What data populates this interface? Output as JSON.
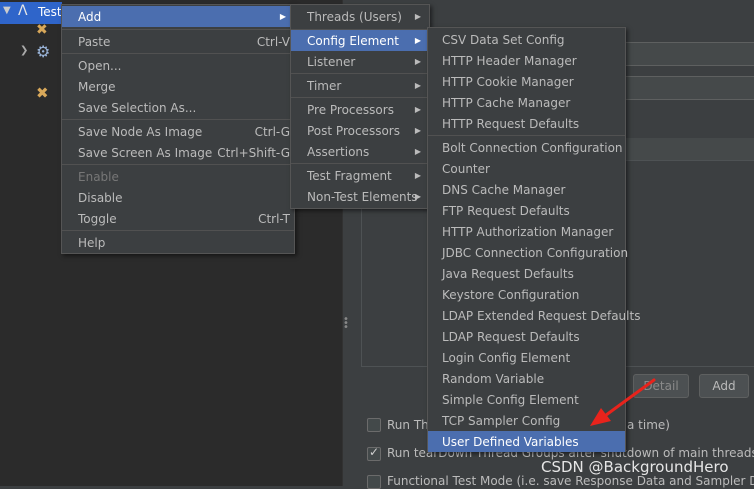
{
  "tree": {
    "selected_label": "Test"
  },
  "context_menu": {
    "items": [
      {
        "label": "Add",
        "shortcut": "",
        "submenu": true
      },
      {
        "label": "Paste",
        "shortcut": "Ctrl-V"
      },
      {
        "label": "Open...",
        "shortcut": ""
      },
      {
        "label": "Merge",
        "shortcut": ""
      },
      {
        "label": "Save Selection As...",
        "shortcut": ""
      },
      {
        "label": "Save Node As Image",
        "shortcut": "Ctrl-G"
      },
      {
        "label": "Save Screen As Image",
        "shortcut": "Ctrl+Shift-G"
      },
      {
        "label": "Enable",
        "shortcut": "",
        "disabled": true
      },
      {
        "label": "Disable",
        "shortcut": ""
      },
      {
        "label": "Toggle",
        "shortcut": "Ctrl-T"
      },
      {
        "label": "Help",
        "shortcut": ""
      }
    ]
  },
  "add_menu": {
    "items": [
      {
        "label": "Threads (Users)"
      },
      {
        "label": "Config Element"
      },
      {
        "label": "Listener"
      },
      {
        "label": "Timer"
      },
      {
        "label": "Pre Processors"
      },
      {
        "label": "Post Processors"
      },
      {
        "label": "Assertions"
      },
      {
        "label": "Test Fragment"
      },
      {
        "label": "Non-Test Elements"
      }
    ]
  },
  "config_menu": {
    "items": [
      "CSV Data Set Config",
      "HTTP Header Manager",
      "HTTP Cookie Manager",
      "HTTP Cache Manager",
      "HTTP Request Defaults",
      "Bolt Connection Configuration",
      "Counter",
      "DNS Cache Manager",
      "FTP Request Defaults",
      "HTTP Authorization Manager",
      "JDBC Connection Configuration",
      "Java Request Defaults",
      "Keystore Configuration",
      "LDAP Extended Request Defaults",
      "LDAP Request Defaults",
      "Login Config Element",
      "Random Variable",
      "Simple Config Element",
      "TCP Sampler Config",
      "User Defined Variables"
    ]
  },
  "right_panel": {
    "detail_button": "Detail",
    "add_button": "Add",
    "option1_visible": "Run Th",
    "option1_tail": "a time)",
    "option2": "Run tearDown Thread Groups after shutdown of main threads",
    "option3": "Functional Test Mode (i.e. save Response Data and Sampler Data)"
  },
  "watermark": "CSDN @BackgroundHero",
  "colors": {
    "selection": "#4b6eaf",
    "arrow": "#e8231c",
    "background": "#3c3f41"
  }
}
